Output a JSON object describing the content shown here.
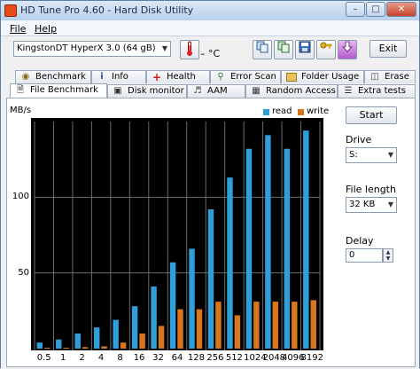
{
  "window": {
    "title": "HD Tune Pro 4.60 - Hard Disk Utility"
  },
  "menu": {
    "file": "File",
    "help": "Help"
  },
  "toolbar": {
    "drive_select": "KingstonDT HyperX 3.0    (64 gB)",
    "temperature": "– °C",
    "exit_label": "Exit"
  },
  "tabs_row1": [
    {
      "label": "Benchmark",
      "icon": "gauge-icon"
    },
    {
      "label": "Info",
      "icon": "info-icon"
    },
    {
      "label": "Health",
      "icon": "health-cross-icon"
    },
    {
      "label": "Error Scan",
      "icon": "magnifier-icon"
    },
    {
      "label": "Folder Usage",
      "icon": "folder-icon"
    },
    {
      "label": "Erase",
      "icon": "trash-icon"
    }
  ],
  "tabs_row2": [
    {
      "label": "File Benchmark",
      "icon": "file-icon",
      "active": true
    },
    {
      "label": "Disk monitor",
      "icon": "monitor-icon"
    },
    {
      "label": "AAM",
      "icon": "speaker-icon"
    },
    {
      "label": "Random Access",
      "icon": "grid-icon"
    },
    {
      "label": "Extra tests",
      "icon": "list-icon"
    }
  ],
  "side": {
    "start_label": "Start",
    "drive_label": "Drive",
    "drive_value": "S:",
    "file_length_label": "File length",
    "file_length_value": "32 KB",
    "delay_label": "Delay",
    "delay_value": "0"
  },
  "chart_data": {
    "type": "bar",
    "ylabel": "MB/s",
    "ylim": [
      0,
      150
    ],
    "yticks": [
      50,
      100
    ],
    "categories": [
      "0.5",
      "1",
      "2",
      "4",
      "8",
      "16",
      "32",
      "64",
      "128",
      "256",
      "512",
      "1024",
      "2048",
      "4096",
      "8192"
    ],
    "series": [
      {
        "name": "read",
        "color": "#2e9fd8",
        "values": [
          4,
          6,
          10,
          14,
          19,
          28,
          41,
          57,
          66,
          92,
          113,
          132,
          141,
          132,
          144
        ]
      },
      {
        "name": "write",
        "color": "#d9751a",
        "values": [
          0.6,
          0.6,
          1,
          1.5,
          4,
          10,
          15,
          26,
          26,
          31,
          22,
          31,
          31,
          31,
          32
        ]
      }
    ],
    "legend": "top-right",
    "grid": true
  }
}
